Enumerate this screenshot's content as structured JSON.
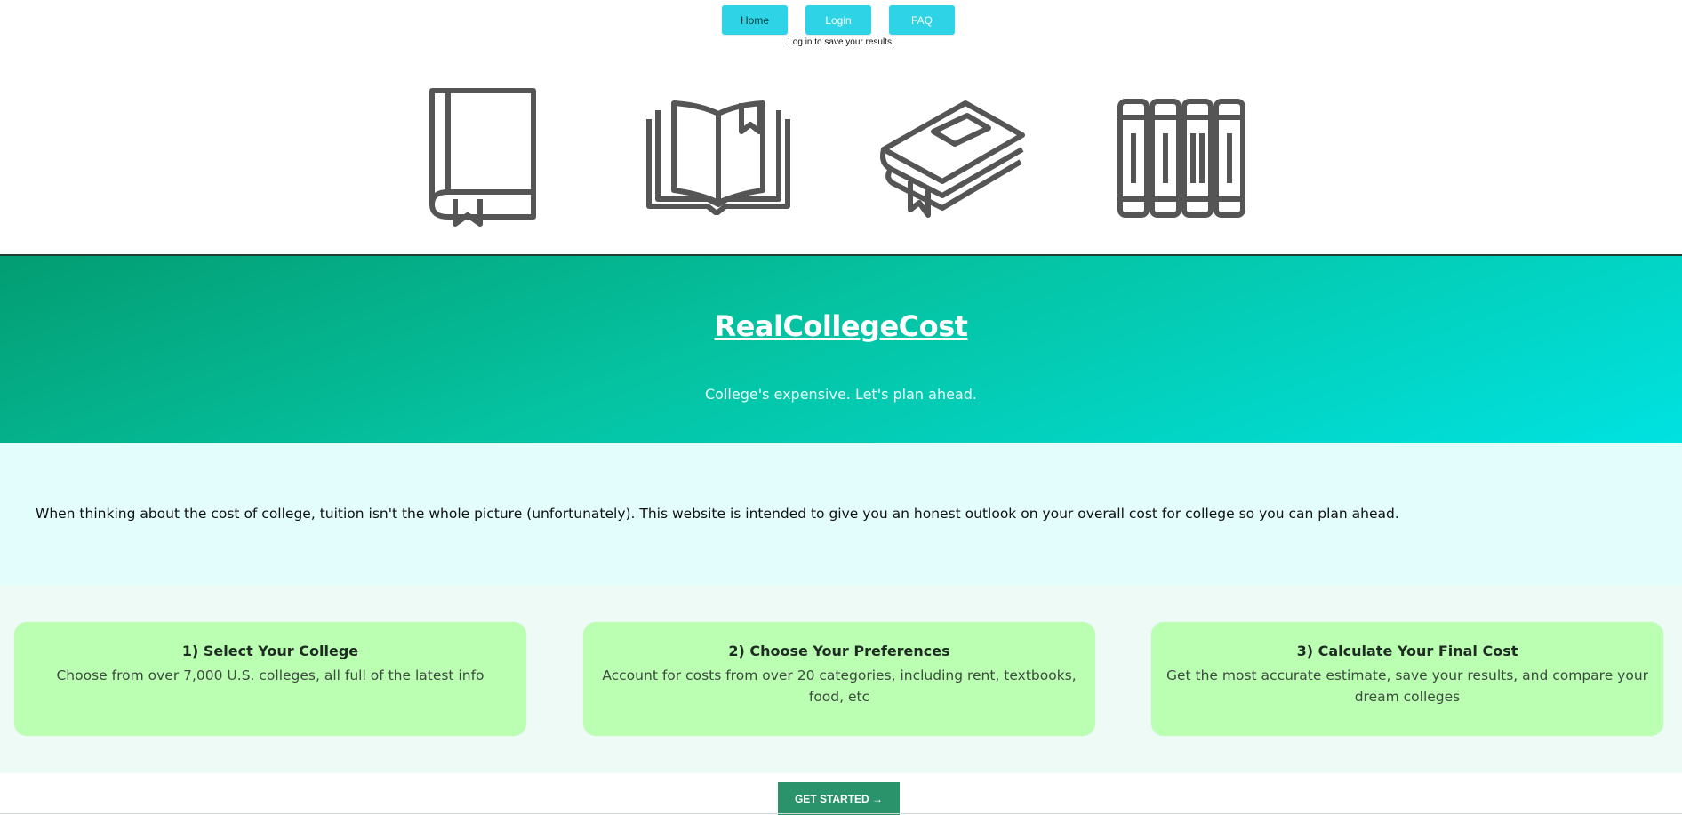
{
  "nav": {
    "home_label": "Home",
    "login_label": "Login",
    "faq_label": "FAQ",
    "login_note": "Log in to save your results!"
  },
  "icons": [
    "closed-book-icon",
    "open-book-icon",
    "lying-book-icon",
    "bookshelf-icon"
  ],
  "hero": {
    "title": "RealCollegeCost",
    "subtitle": "College's expensive. Let's plan ahead."
  },
  "intro": {
    "text": "When thinking about the cost of college, tuition isn't the whole picture (unfortunately). This website is intended to give you an honest outlook on your overall cost for college so you can plan ahead."
  },
  "steps": [
    {
      "title": "1) Select Your College",
      "text": "Choose from over 7,000 U.S. colleges, all full of the latest info"
    },
    {
      "title": "2) Choose Your Preferences",
      "text": "Account for costs from over 20 categories, including rent, textbooks, food, etc"
    },
    {
      "title": "3) Calculate Your Final Cost",
      "text": "Get the most accurate estimate, save your results, and compare your dream colleges"
    }
  ],
  "cta": {
    "label": "GET STARTED →"
  },
  "colors": {
    "nav_button": "#2ed4e6",
    "hero_start": "#039d72",
    "hero_end": "#00e2e1",
    "intro_bg": "#e3fdfd",
    "card_bg": "#bbffb3",
    "cta_bg": "#2a936c"
  }
}
